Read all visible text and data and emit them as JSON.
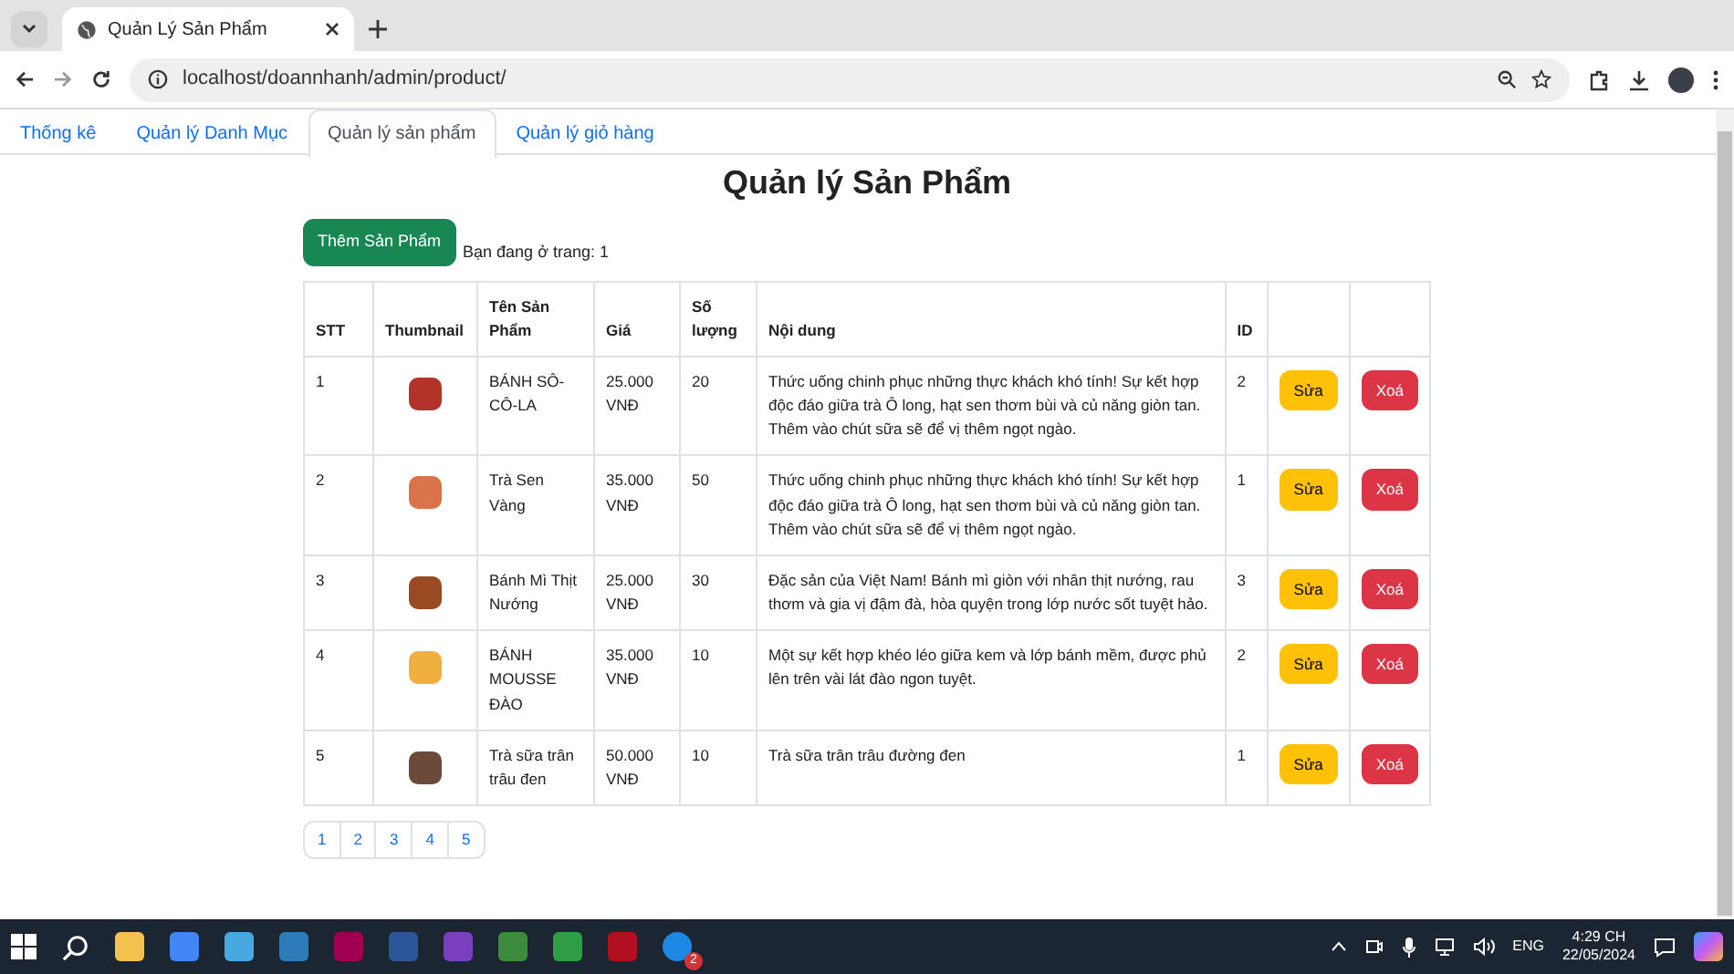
{
  "browser": {
    "tab_title": "Quản Lý Sản Phẩm",
    "url": "localhost/doannhanh/admin/product/"
  },
  "nav_tabs": [
    {
      "label": "Thống kê",
      "selected": false
    },
    {
      "label": "Quản lý Danh Mục",
      "selected": false
    },
    {
      "label": "Quản lý sản phẩm",
      "selected": true
    },
    {
      "label": "Quản lý giỏ hàng",
      "selected": false
    }
  ],
  "page": {
    "title": "Quản lý Sản Phẩm",
    "add_button": "Thêm Sản Phẩm",
    "page_info": "Bạn đang ở trang: 1"
  },
  "table": {
    "columns": [
      "STT",
      "Thumbnail",
      "Tên Sản Phẩm",
      "Giá",
      "Số lượng",
      "Nội dung",
      "ID"
    ],
    "rows": [
      {
        "stt": "1",
        "name": "BÁNH SÔ-CÔ-LA",
        "price": "25.000 VNĐ",
        "quantity": "20",
        "description": "Thức uống chinh phục những thực khách khó tính! Sự kết hợp độc đáo giữa trà Ô long, hạt sen thơm bùi và củ năng giòn tan. Thêm vào chút sữa sẽ để vị thêm ngọt ngào.",
        "id": "2",
        "edit": "Sửa",
        "delete": "Xoá"
      },
      {
        "stt": "2",
        "name": "Trà Sen Vàng",
        "price": "35.000 VNĐ",
        "quantity": "50",
        "description": "Thức uống chinh phục những thực khách khó tính! Sự kết hợp độc đáo giữa trà Ô long, hạt sen thơm bùi và củ năng giòn tan. Thêm vào chút sữa sẽ để vị thêm ngọt ngào.",
        "id": "1",
        "edit": "Sửa",
        "delete": "Xoá"
      },
      {
        "stt": "3",
        "name": "Bánh Mì Thịt Nướng",
        "price": "25.000 VNĐ",
        "quantity": "30",
        "description": "Đặc sản của Việt Nam! Bánh mì giòn với nhân thịt nướng, rau thơm và gia vị đậm đà, hòa quyện trong lớp nước sốt tuyệt hảo.",
        "id": "3",
        "edit": "Sửa",
        "delete": "Xoá"
      },
      {
        "stt": "4",
        "name": "BÁNH MOUSSE ĐÀO",
        "price": "35.000 VNĐ",
        "quantity": "10",
        "description": "Một sự kết hợp khéo léo giữa kem và lớp bánh mềm, được phủ lên trên vài lát đào ngon tuyệt.",
        "id": "2",
        "edit": "Sửa",
        "delete": "Xoá"
      },
      {
        "stt": "5",
        "name": "Trà sữa trân trâu đen",
        "price": "50.000 VNĐ",
        "quantity": "10",
        "description": "Trà sữa trân trâu đường đen",
        "id": "1",
        "edit": "Sửa",
        "delete": "Xoá"
      }
    ]
  },
  "pagination": [
    "1",
    "2",
    "3",
    "4",
    "5"
  ],
  "taskbar": {
    "badge": "2",
    "language": "ENG",
    "time": "4:29 CH",
    "date": "22/05/2024"
  }
}
